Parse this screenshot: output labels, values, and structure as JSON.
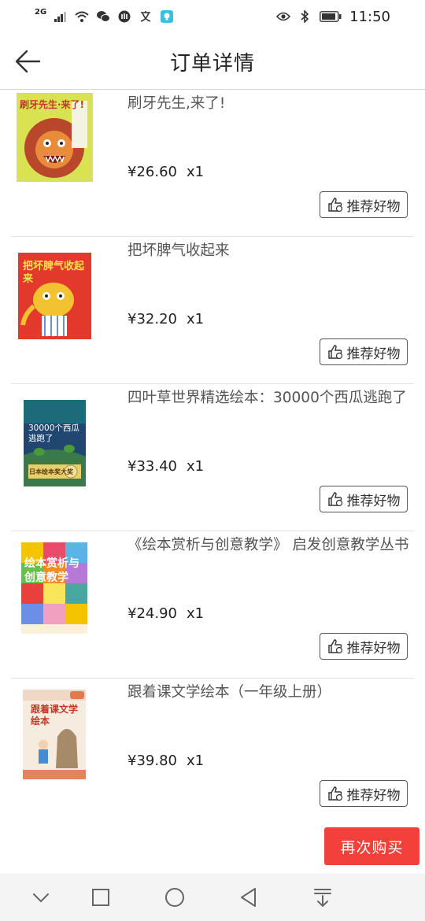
{
  "status_bar": {
    "network": "2G",
    "time": "11:50",
    "left_icons": [
      "signal-icon",
      "wifi-icon",
      "wechat-icon",
      "app-icon",
      "translate-icon",
      "notification-icon"
    ],
    "right_icons": [
      "eye-icon",
      "bluetooth-icon",
      "battery-icon"
    ]
  },
  "header": {
    "title": "订单详情"
  },
  "items": [
    {
      "name": "刷牙先生,来了!",
      "price": "¥26.60",
      "qty": "x1",
      "recommend_label": "推荐好物"
    },
    {
      "name": "把坏脾气收起来",
      "price": "¥32.20",
      "qty": "x1",
      "recommend_label": "推荐好物"
    },
    {
      "name": "四叶草世界精选绘本：30000个西瓜逃跑了",
      "price": "¥33.40",
      "qty": "x1",
      "recommend_label": "推荐好物"
    },
    {
      "name": "《绘本赏析与创意教学》 启发创意教学丛书",
      "price": "¥24.90",
      "qty": "x1",
      "recommend_label": "推荐好物"
    },
    {
      "name": "跟着课文学绘本（一年级上册）",
      "price": "¥39.80",
      "qty": "x1",
      "recommend_label": "推荐好物"
    }
  ],
  "covers": [
    {
      "text": "刷牙先生·来了!",
      "bg": "#d7e04a",
      "accent": "#c0392b"
    },
    {
      "text": "把坏脾气收起来",
      "bg": "#e0372c",
      "accent": "#f2c230"
    },
    {
      "text": "30000个西瓜逃跑了",
      "sub": "日本绘本奖大奖",
      "bg": "#234a74",
      "accent": "#d8b85a"
    },
    {
      "text": "绘本赏析与创意教学",
      "bg": "#f6d23a",
      "accent": "#e8403b"
    },
    {
      "text": "跟着课文学绘本",
      "bg": "#f4e9dc",
      "accent": "#e07a4f"
    }
  ],
  "footer": {
    "buy_again": "再次购买"
  },
  "colors": {
    "primary": "#f4403b",
    "divider": "#e2e2e2"
  }
}
